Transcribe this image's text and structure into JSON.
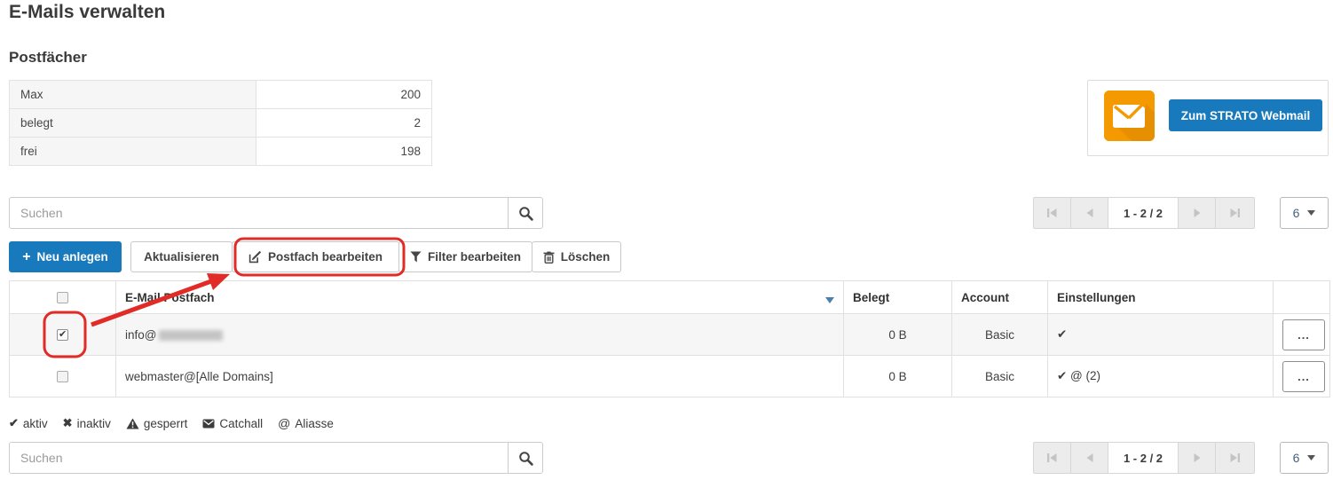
{
  "colors": {
    "accent_blue": "#187abc",
    "brand_orange": "#f59901",
    "annotation_red": "#e12b27",
    "sort_caret_blue": "#4a7fae"
  },
  "page": {
    "title": "E-Mails verwalten",
    "section_title": "Postfächer"
  },
  "stats": {
    "rows": [
      {
        "label": "Max",
        "value": "200"
      },
      {
        "label": "belegt",
        "value": "2"
      },
      {
        "label": "frei",
        "value": "198"
      }
    ]
  },
  "webmail": {
    "button_label": "Zum STRATO Webmail"
  },
  "search_top": {
    "placeholder": "Suchen"
  },
  "search_bottom": {
    "placeholder": "Suchen"
  },
  "pagination": {
    "range_label": "1 - 2 / 2",
    "page_size": "6"
  },
  "toolbar": {
    "new_label": "Neu anlegen",
    "refresh_label": "Aktualisieren",
    "edit_label": "Postfach bearbeiten",
    "filter_label": "Filter bearbeiten",
    "delete_label": "Löschen"
  },
  "table": {
    "headers": {
      "email": "E-Mail Postfach",
      "usage": "Belegt",
      "account": "Account",
      "settings": "Einstellungen"
    },
    "rows": [
      {
        "email_prefix": "info@",
        "email_domain_hidden": true,
        "usage": "0 B",
        "account": "Basic",
        "settings": "✔",
        "checked": true,
        "actions_label": "..."
      },
      {
        "email_prefix": "webmaster@[Alle Domains]",
        "usage": "0 B",
        "account": "Basic",
        "settings": "✔ @ (2)",
        "checked": false,
        "actions_label": "..."
      }
    ]
  },
  "legend": {
    "items": [
      {
        "icon": "check-icon",
        "glyph": "✔",
        "label": "aktiv"
      },
      {
        "icon": "cross-icon",
        "glyph": "✖",
        "label": "inaktiv"
      },
      {
        "icon": "warning-icon",
        "glyph": "",
        "label": "gesperrt"
      },
      {
        "icon": "catchall-envelope-icon",
        "glyph": "",
        "label": "Catchall"
      },
      {
        "icon": "at-icon",
        "glyph": "@",
        "label": "Aliasse"
      }
    ]
  },
  "icons": {
    "plus": "+"
  }
}
